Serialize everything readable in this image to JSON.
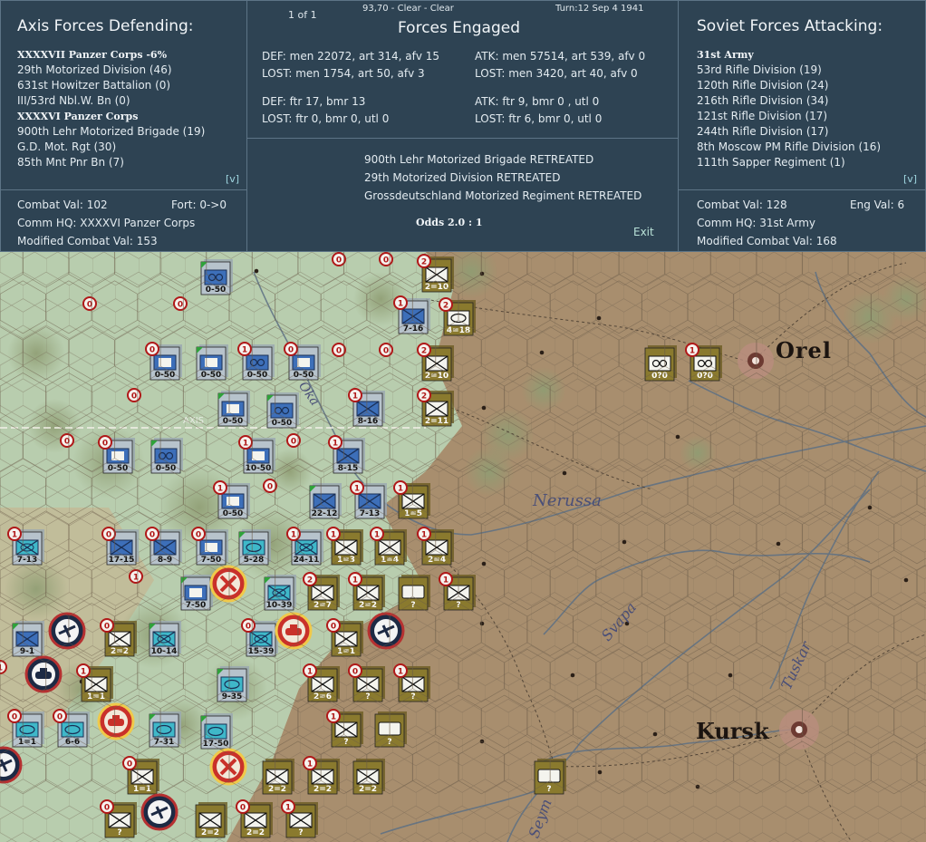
{
  "header": {
    "page_indicator": "1 of 1",
    "coords_weather": "93,70 - Clear - Clear",
    "turn_date": "Turn:12  Sep 4 1941"
  },
  "axis": {
    "title": "Axis Forces Defending:",
    "units": [
      {
        "text": "XXXXVII Panzer Corps  -6%",
        "type": "hdr"
      },
      {
        "text": "29th Motorized Division (46)",
        "type": "txt"
      },
      {
        "text": "631st Howitzer Battalion (0)",
        "type": "txt"
      },
      {
        "text": "III/53rd Nbl.W. Bn (0)",
        "type": "txt"
      },
      {
        "text": "XXXXVI Panzer Corps",
        "type": "hdr"
      },
      {
        "text": "900th Lehr Motorized Brigade (19)",
        "type": "txt"
      },
      {
        "text": "G.D. Mot. Rgt (30)",
        "type": "txt"
      },
      {
        "text": "85th Mnt Pnr Bn (7)",
        "type": "txt"
      }
    ],
    "expand": "[v]",
    "combat_val": "Combat Val: 102",
    "fort": "Fort: 0->0",
    "comm_hq": "Comm HQ: XXXXVI Panzer Corps",
    "modified": "Modified Combat Val: 153"
  },
  "engaged": {
    "title": "Forces Engaged",
    "def_men": "DEF: men 22072, art 314, afv 15",
    "def_lost": "LOST: men 1754, art 50, afv 3",
    "atk_men": "ATK: men 57514, art 539, afv 0",
    "atk_lost": "LOST: men 3420, art 40, afv 0",
    "def_air": "DEF: ftr 17, bmr 13",
    "def_air_lost": "LOST: ftr 0, bmr 0, utl 0",
    "atk_air": "ATK: ftr 9, bmr 0 , utl 0",
    "atk_air_lost": "LOST: ftr 6, bmr 0, utl 0",
    "results": [
      "900th Lehr Motorized Brigade RETREATED",
      "29th Motorized Division RETREATED",
      "Grossdeutschland Motorized Regiment RETREATED"
    ],
    "odds": "Odds 2.0 : 1",
    "exit": "Exit"
  },
  "soviet": {
    "title": "Soviet Forces Attacking:",
    "units": [
      {
        "text": "31st Army",
        "type": "hdr"
      },
      {
        "text": "53rd Rifle Division (19)",
        "type": "txt"
      },
      {
        "text": "120th Rifle Division (24)",
        "type": "txt"
      },
      {
        "text": "216th Rifle Division (34)",
        "type": "txt"
      },
      {
        "text": "121st Rifle Division (17)",
        "type": "txt"
      },
      {
        "text": "244th Rifle Division (17)",
        "type": "txt"
      },
      {
        "text": "8th Moscow PM Rifle Division (16)",
        "type": "txt"
      },
      {
        "text": "111th Sapper Regiment (1)",
        "type": "txt"
      }
    ],
    "expand": "[v]",
    "combat_val": "Combat Val: 128",
    "eng_val": "Eng Val: 6",
    "comm_hq": "Comm HQ: 31st Army",
    "modified": "Modified Combat Val: 168"
  },
  "map": {
    "cities": [
      "Orel",
      "Kursk"
    ],
    "rivers": [
      "Nerussa",
      "Svapa",
      "Tuskar",
      "Seym",
      "Oka"
    ],
    "axis_label": "AXIS",
    "colors": {
      "terrain_steppe": "#a88e6e",
      "terrain_clear": "#b9cfae",
      "german_counter": "#b7c3cc",
      "soviet_counter": "#8a7a2e",
      "zoc_marker": "#b01818"
    },
    "counters": [
      {
        "side": "de",
        "icon": "motor",
        "label": "0-50",
        "marker": ""
      },
      {
        "side": "de",
        "icon": "hq",
        "label": "0-50",
        "marker": "0"
      },
      {
        "side": "de",
        "icon": "hq",
        "label": "0-50",
        "marker": ""
      },
      {
        "side": "de",
        "icon": "motor",
        "label": "0-50",
        "marker": "1"
      },
      {
        "side": "de",
        "icon": "hq",
        "label": "0-50",
        "marker": "0"
      },
      {
        "side": "de",
        "icon": "hq",
        "label": "0-50",
        "marker": ""
      },
      {
        "side": "de",
        "icon": "motor",
        "label": "0-50",
        "marker": ""
      },
      {
        "side": "de",
        "icon": "hq",
        "label": "0-50",
        "marker": "0"
      },
      {
        "side": "de",
        "icon": "motor",
        "label": "0-50",
        "marker": ""
      },
      {
        "side": "de",
        "icon": "hq",
        "label": "10-50",
        "marker": "1"
      },
      {
        "side": "de",
        "icon": "hq",
        "label": "0-50",
        "marker": "1"
      },
      {
        "side": "de",
        "icon": "inf",
        "label": "7-16",
        "marker": "1"
      },
      {
        "side": "de",
        "icon": "inf",
        "label": "8-16",
        "marker": "1"
      },
      {
        "side": "de",
        "icon": "inf",
        "label": "8-15",
        "marker": "1"
      },
      {
        "side": "de",
        "icon": "inf",
        "label": "22-12",
        "marker": ""
      },
      {
        "side": "de",
        "icon": "mech",
        "label": "7-13",
        "marker": "1"
      },
      {
        "side": "de",
        "icon": "inf",
        "label": "7-13",
        "marker": "1"
      },
      {
        "side": "de",
        "icon": "inf",
        "label": "17-15",
        "marker": "0"
      },
      {
        "side": "de",
        "icon": "inf",
        "label": "8-9",
        "marker": "0"
      },
      {
        "side": "de",
        "icon": "hq",
        "label": "7-50",
        "marker": "0"
      },
      {
        "side": "de",
        "icon": "armor",
        "label": "5-28",
        "marker": ""
      },
      {
        "side": "de",
        "icon": "mech",
        "label": "24-11",
        "marker": "1"
      },
      {
        "side": "de",
        "icon": "hq",
        "label": "7-50",
        "marker": ""
      },
      {
        "side": "de",
        "icon": "mech",
        "label": "10-39",
        "marker": ""
      },
      {
        "side": "de",
        "icon": "inf",
        "label": "9-1",
        "marker": ""
      },
      {
        "side": "de",
        "icon": "mech",
        "label": "10-14",
        "marker": ""
      },
      {
        "side": "de",
        "icon": "mech",
        "label": "15-39",
        "marker": "0"
      },
      {
        "side": "de",
        "icon": "armor",
        "label": "9-35",
        "marker": ""
      },
      {
        "side": "de",
        "icon": "armor",
        "label": "6-6",
        "marker": "0"
      },
      {
        "side": "de",
        "icon": "armor",
        "label": "7-31",
        "marker": ""
      },
      {
        "side": "de",
        "icon": "armor",
        "label": "17-50",
        "marker": ""
      },
      {
        "side": "de",
        "icon": "armor",
        "label": "1=1",
        "marker": "0"
      },
      {
        "side": "su",
        "icon": "inf",
        "label": "2=10",
        "marker": "2"
      },
      {
        "side": "su",
        "icon": "armor",
        "label": "4=18",
        "marker": "2"
      },
      {
        "side": "su",
        "icon": "inf",
        "label": "2=10",
        "marker": "2"
      },
      {
        "side": "su",
        "icon": "inf",
        "label": "2=11",
        "marker": "2"
      },
      {
        "side": "su",
        "icon": "inf",
        "label": "1=5",
        "marker": "1"
      },
      {
        "side": "su",
        "icon": "inf",
        "label": "1=3",
        "marker": "1"
      },
      {
        "side": "su",
        "icon": "inf",
        "label": "1=4",
        "marker": "1"
      },
      {
        "side": "su",
        "icon": "inf",
        "label": "2=4",
        "marker": "1"
      },
      {
        "side": "su",
        "icon": "inf",
        "label": "2=7",
        "marker": "2"
      },
      {
        "side": "su",
        "icon": "inf",
        "label": "2=2",
        "marker": "1"
      },
      {
        "side": "su",
        "icon": "blank",
        "label": "?",
        "marker": ""
      },
      {
        "side": "su",
        "icon": "inf",
        "label": "?",
        "marker": "1"
      },
      {
        "side": "su",
        "icon": "inf",
        "label": "2=2",
        "marker": "0"
      },
      {
        "side": "su",
        "icon": "inf",
        "label": "1=1",
        "marker": "0"
      },
      {
        "side": "su",
        "icon": "inf",
        "label": "1=1",
        "marker": "1"
      },
      {
        "side": "su",
        "icon": "inf",
        "label": "2=6",
        "marker": "1"
      },
      {
        "side": "su",
        "icon": "inf",
        "label": "?",
        "marker": "0"
      },
      {
        "side": "su",
        "icon": "inf",
        "label": "?",
        "marker": "1"
      },
      {
        "side": "su",
        "icon": "inf",
        "label": "?",
        "marker": "1"
      },
      {
        "side": "su",
        "icon": "blank",
        "label": "?",
        "marker": ""
      },
      {
        "side": "su",
        "icon": "inf",
        "label": "2=2",
        "marker": ""
      },
      {
        "side": "su",
        "icon": "inf",
        "label": "2=2",
        "marker": "1"
      },
      {
        "side": "su",
        "icon": "inf",
        "label": "2=2",
        "marker": ""
      },
      {
        "side": "su",
        "icon": "blank",
        "label": "?",
        "marker": ""
      },
      {
        "side": "su",
        "icon": "inf",
        "label": "?",
        "marker": "0"
      },
      {
        "side": "su",
        "icon": "inf",
        "label": "1=1",
        "marker": "0"
      },
      {
        "side": "su",
        "icon": "inf",
        "label": "2=2",
        "marker": ""
      },
      {
        "side": "su",
        "icon": "inf",
        "label": "2=2",
        "marker": "0"
      },
      {
        "side": "su",
        "icon": "inf",
        "label": "?",
        "marker": "1"
      },
      {
        "side": "su",
        "icon": "motor",
        "label": "0?0",
        "marker": ""
      },
      {
        "side": "su",
        "icon": "motor",
        "label": "0?0",
        "marker": "1"
      }
    ],
    "markers": [
      "0",
      "0",
      "0",
      "0",
      "0",
      "0",
      "0",
      "0",
      "0",
      "0",
      "1",
      "1"
    ]
  }
}
